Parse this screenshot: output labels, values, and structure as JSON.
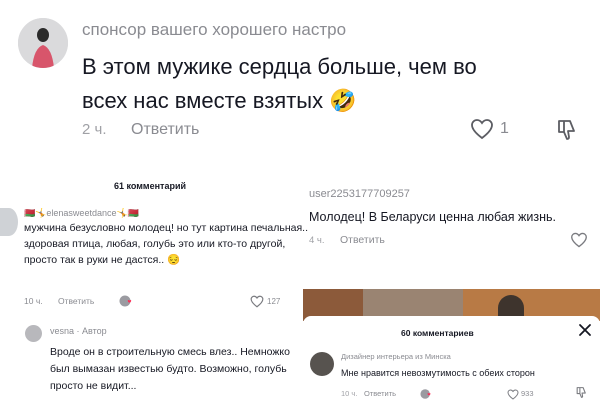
{
  "top_comment": {
    "username": "спонсор вашего хорошего настро",
    "text": "В этом мужике сердца больше, чем во всех нас вместе взятых 🤣",
    "time": "2 ч.",
    "reply_label": "Ответить",
    "likes": "1",
    "icons": [
      "avatar",
      "heart-icon",
      "dislike-icon"
    ]
  },
  "left_panel": {
    "comments_count_label": "61 комментарий",
    "comment": {
      "username": "🇧🇾🤸elenasweetdance🤸🇧🇾",
      "text": "мужчина безусловно молодец! но тут картина печальная.. здоровая птица, любая, голубь это или кто-то другой, просто так в руки не дастся.. 😔",
      "time": "10 ч.",
      "reply_label": "Ответить",
      "likes": "127"
    },
    "reply": {
      "username": "vesna · Автор",
      "text": "Вроде он в строительную смесь влез.. Немножко был вымазан известью будто. Возможно, голубь просто не видит..."
    }
  },
  "right_panel": {
    "comment": {
      "username": "user2253177709257",
      "text": "Молодец! В Беларуси ценна любая жизнь.",
      "time": "4 ч.",
      "reply_label": "Ответить"
    },
    "sheet": {
      "title": "60 комментариев",
      "comment": {
        "username": "Дизайнер интерьера из Минска",
        "text": "Мне нравится невозмутимость с обеих сторон",
        "time": "10 ч.",
        "reply_label": "Ответить",
        "likes": "933"
      }
    }
  },
  "colors": {
    "text_primary": "#161823",
    "text_muted": "#8a8b91",
    "background": "#ffffff"
  }
}
